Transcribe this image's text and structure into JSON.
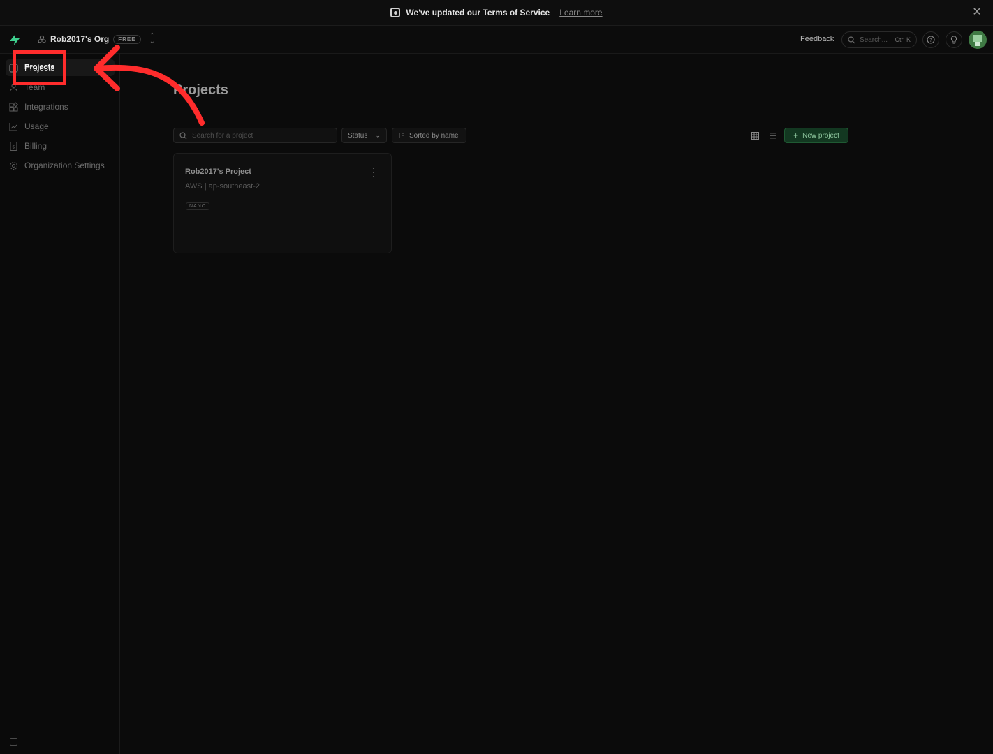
{
  "banner": {
    "message": "We've updated our Terms of Service",
    "link": "Learn more",
    "close_icon": "close-icon"
  },
  "topbar": {
    "org_name": "Rob2017's Org",
    "plan_badge": "FREE",
    "feedback": "Feedback",
    "search_placeholder": "Search...",
    "search_shortcut": "Ctrl K"
  },
  "sidebar": {
    "items": [
      {
        "label": "Projects",
        "icon": "projects-icon",
        "active": true
      },
      {
        "label": "Team",
        "icon": "team-icon"
      },
      {
        "label": "Integrations",
        "icon": "integrations-icon"
      },
      {
        "label": "Usage",
        "icon": "usage-icon"
      },
      {
        "label": "Billing",
        "icon": "billing-icon"
      },
      {
        "label": "Organization Settings",
        "icon": "settings-icon"
      }
    ]
  },
  "main": {
    "title": "Projects",
    "search_placeholder": "Search for a project",
    "status_label": "Status",
    "sort_label": "Sorted by name",
    "new_project_label": "New project",
    "projects": [
      {
        "name": "Rob2017's Project",
        "region": "AWS | ap-southeast-2",
        "size": "NANO"
      }
    ]
  },
  "annotation": {
    "highlight_label": "Projects",
    "color": "#ff2c2c"
  },
  "colors": {
    "background": "#0b0b0b",
    "accent_green": "#3ecf8e",
    "new_button": "#133821"
  }
}
